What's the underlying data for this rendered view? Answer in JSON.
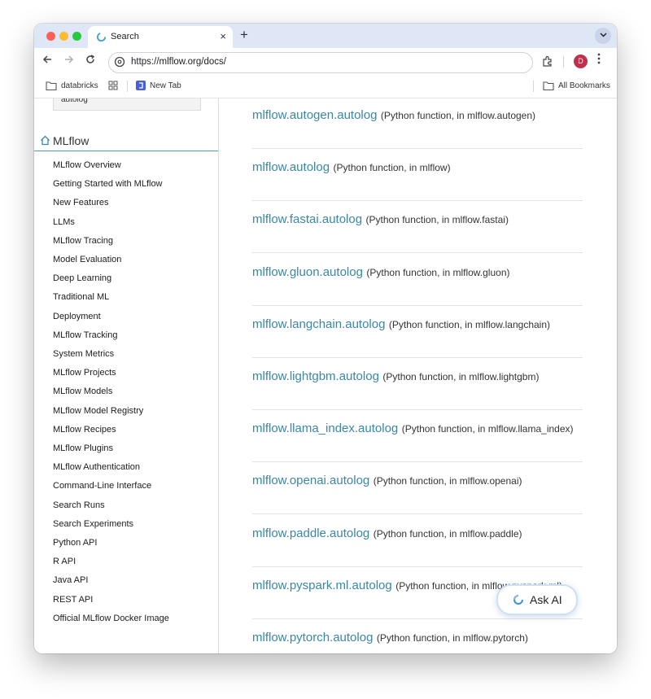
{
  "browser": {
    "tab_title": "Search",
    "tab_close": "×",
    "new_tab": "+",
    "url": "https://mlflow.org/docs/",
    "avatar_initial": "D"
  },
  "bookmarks": {
    "items": [
      "databricks",
      "New Tab"
    ],
    "all_bookmarks": "All Bookmarks"
  },
  "sidebar": {
    "search_result_snippet": "autolog",
    "section_title": "MLflow",
    "items": [
      "MLflow Overview",
      "Getting Started with MLflow",
      "New Features",
      "LLMs",
      "MLflow Tracing",
      "Model Evaluation",
      "Deep Learning",
      "Traditional ML",
      "Deployment",
      "MLflow Tracking",
      "System Metrics",
      "MLflow Projects",
      "MLflow Models",
      "MLflow Model Registry",
      "MLflow Recipes",
      "MLflow Plugins",
      "MLflow Authentication",
      "Command-Line Interface",
      "Search Runs",
      "Search Experiments",
      "Python API",
      "R API",
      "Java API",
      "REST API",
      "Official MLflow Docker Image"
    ]
  },
  "results": [
    {
      "name": "mlflow.autogen.autolog",
      "desc": "(Python function, in mlflow.autogen)"
    },
    {
      "name": "mlflow.autolog",
      "desc": "(Python function, in mlflow)"
    },
    {
      "name": "mlflow.fastai.autolog",
      "desc": "(Python function, in mlflow.fastai)"
    },
    {
      "name": "mlflow.gluon.autolog",
      "desc": "(Python function, in mlflow.gluon)"
    },
    {
      "name": "mlflow.langchain.autolog",
      "desc": "(Python function, in mlflow.langchain)"
    },
    {
      "name": "mlflow.lightgbm.autolog",
      "desc": "(Python function, in mlflow.lightgbm)"
    },
    {
      "name": "mlflow.llama_index.autolog",
      "desc": "(Python function, in mlflow.llama_index)"
    },
    {
      "name": "mlflow.openai.autolog",
      "desc": "(Python function, in mlflow.openai)"
    },
    {
      "name": "mlflow.paddle.autolog",
      "desc": "(Python function, in mlflow.paddle)"
    },
    {
      "name": "mlflow.pyspark.ml.autolog",
      "desc": "(Python function, in mlflow.pyspark.ml)"
    },
    {
      "name": "mlflow.pytorch.autolog",
      "desc": "(Python function, in mlflow.pytorch)"
    }
  ],
  "ask_ai": {
    "label": "Ask AI"
  },
  "colors": {
    "link": "#3a87a6",
    "accent_rule": "#4a9fba",
    "tab_strip": "#dfe6f5",
    "avatar": "#c0304d"
  }
}
